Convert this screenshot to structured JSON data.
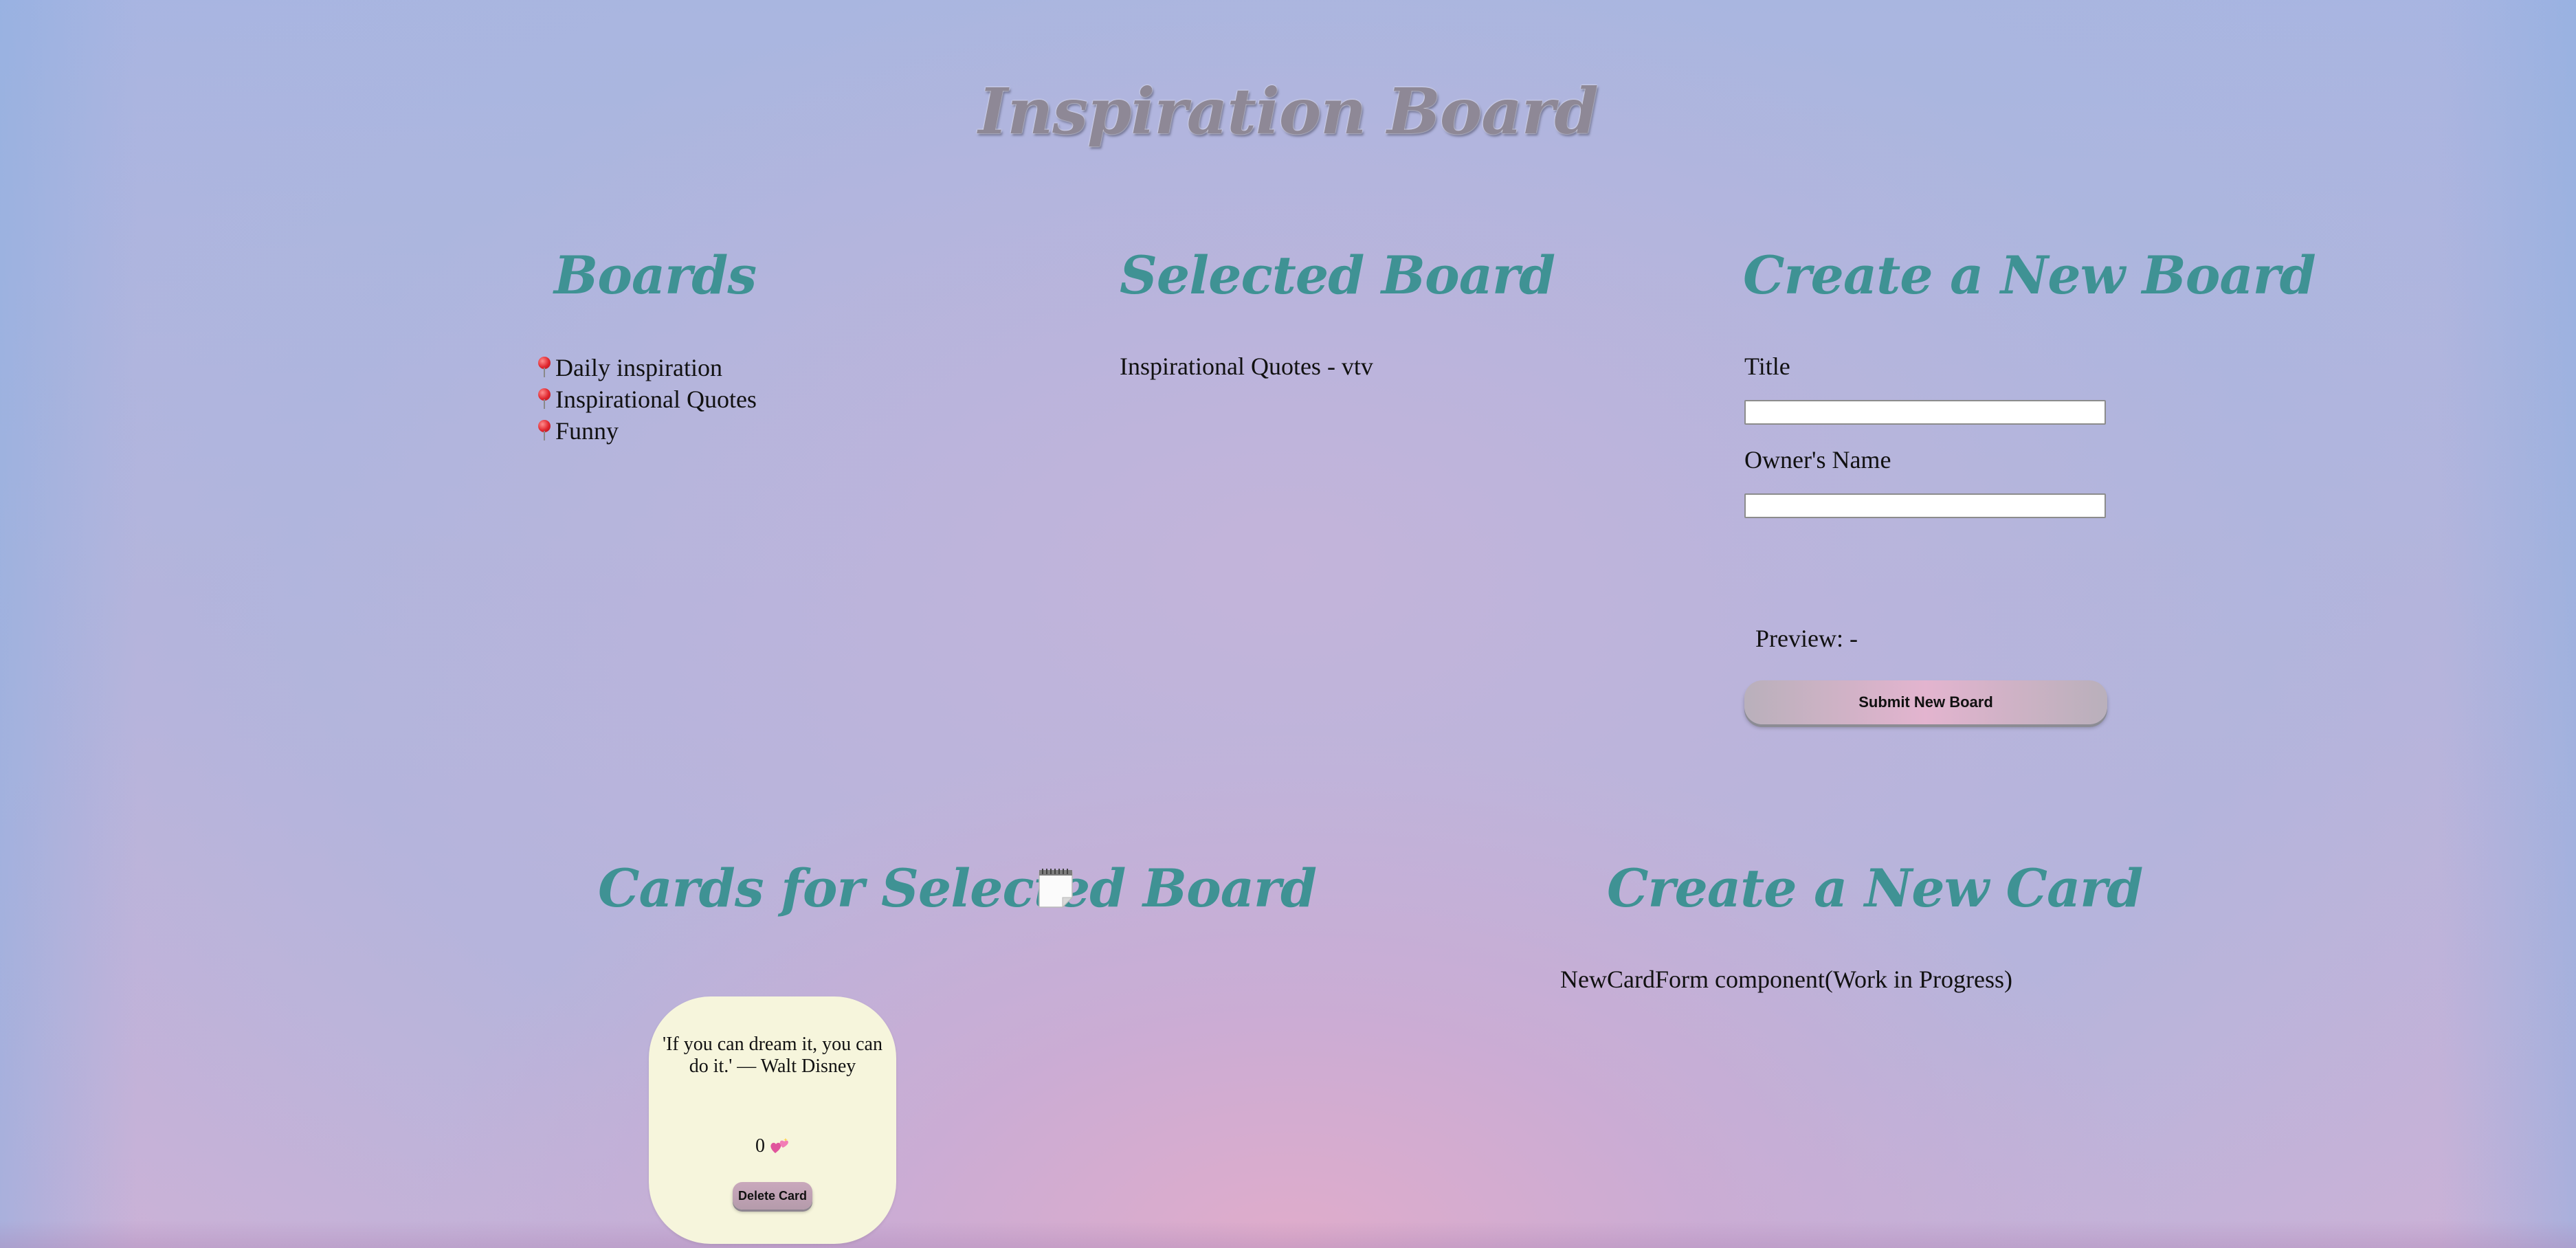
{
  "app": {
    "title": "Inspiration Board"
  },
  "boards_section": {
    "heading": "Boards",
    "items": [
      {
        "label": "Daily inspiration",
        "icon": "pushpin-icon"
      },
      {
        "label": "Inspirational Quotes",
        "icon": "pushpin-icon"
      },
      {
        "label": "Funny",
        "icon": "pushpin-icon"
      }
    ]
  },
  "selected_board_section": {
    "heading": "Selected Board",
    "value": "Inspirational Quotes - vtv"
  },
  "new_board_form": {
    "heading": "Create a New Board",
    "title_label": "Title",
    "title_value": "",
    "owner_label": "Owner's Name",
    "owner_value": "",
    "preview_text": "Preview: -",
    "submit_label": "Submit New Board"
  },
  "cards_section": {
    "heading": "Cards for Selected Board",
    "heading_icon": "notepad-icon",
    "cards": [
      {
        "message": "'If you can dream it, you can do it.' — Walt Disney",
        "likes": "0",
        "like_icon": "hearts-icon",
        "delete_label": "Delete Card"
      }
    ]
  },
  "new_card_section": {
    "heading": "Create a New Card",
    "placeholder_text": "NewCardForm component(Work in Progress)"
  },
  "colors": {
    "heading": "#3f9294",
    "card_background": "#f6f5dc",
    "title_text": "#8e8896"
  }
}
